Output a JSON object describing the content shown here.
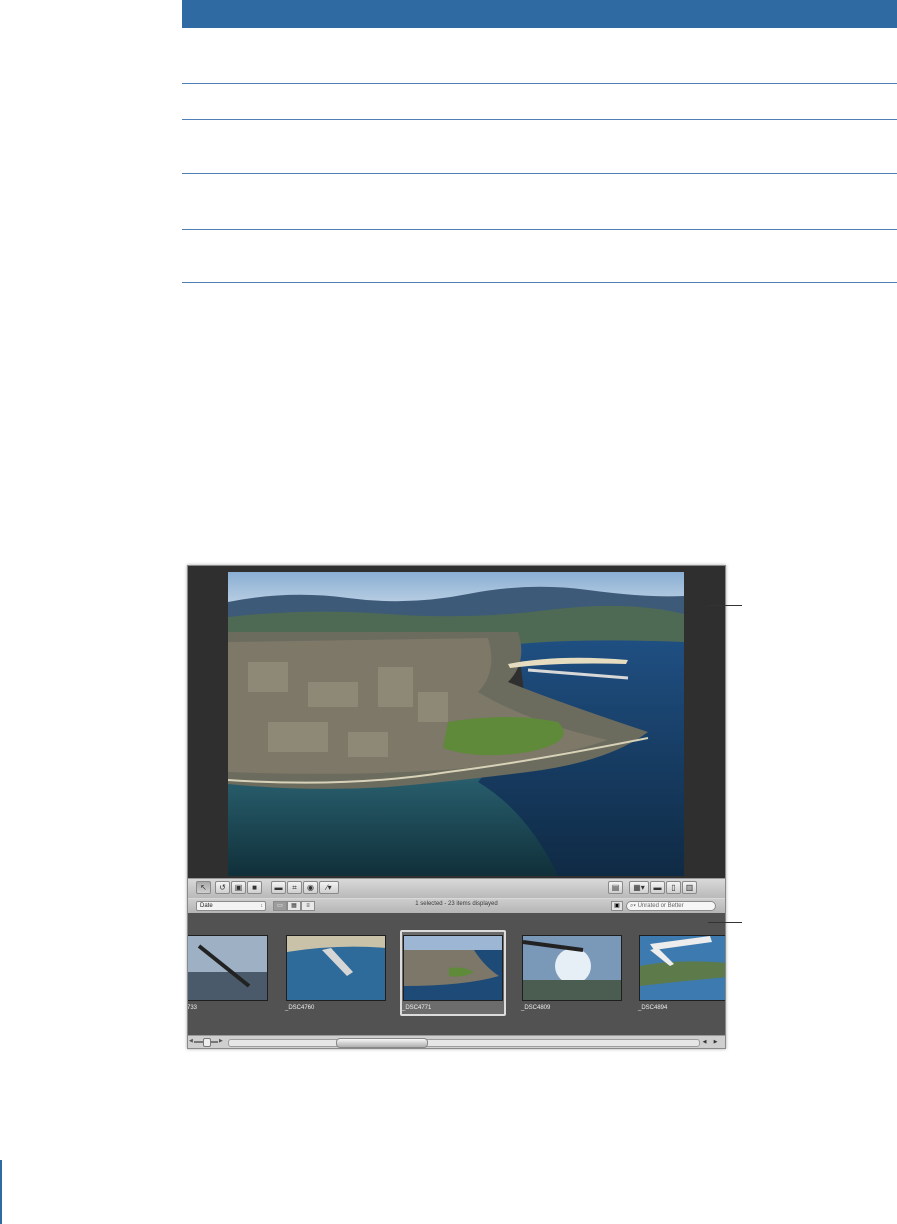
{
  "app": {
    "sort_label": "Date",
    "status_text": "1 selected - 23 items displayed",
    "filter_placeholder": "Unrated or Better"
  },
  "thumbnails": [
    {
      "label": "733"
    },
    {
      "label": "_DSC4760"
    },
    {
      "label": "_DSC4771"
    },
    {
      "label": "_DSC4809"
    },
    {
      "label": "_DSC4894"
    }
  ],
  "icons": {
    "toolbar_left": [
      "pointer-icon",
      "rotate-left-icon",
      "straighten-icon",
      "lift-stamp-icon",
      "crop-icon",
      "redeye-icon",
      "retouch-brush-icon"
    ],
    "toolbar_right": [
      "fullscreen-icon",
      "show-images-icon",
      "inspector-icon",
      "viewer-icon",
      "filmstrip-icon"
    ],
    "view_modes": [
      "filmstrip-view-icon",
      "grid-view-icon",
      "list-view-icon"
    ]
  },
  "colors": {
    "header_blue": "#2f6aa2",
    "rule_blue": "#4f7fb5"
  }
}
